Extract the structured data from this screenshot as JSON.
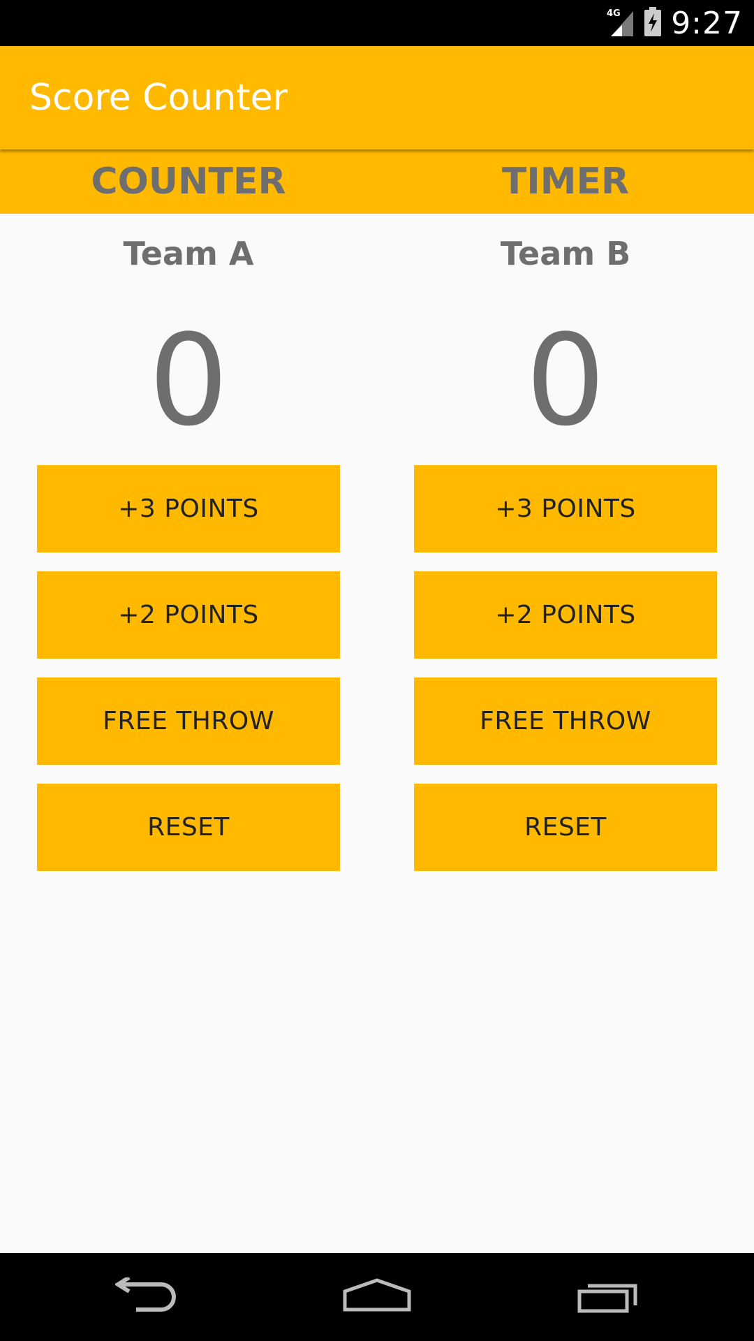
{
  "status_bar": {
    "network": "4G",
    "time": "9:27"
  },
  "app_bar": {
    "title": "Score Counter"
  },
  "tabs": [
    {
      "label": "COUNTER"
    },
    {
      "label": "TIMER"
    }
  ],
  "teams": [
    {
      "name": "Team A",
      "score": "0",
      "buttons": [
        "+3 POINTS",
        "+2 POINTS",
        "FREE THROW",
        "RESET"
      ]
    },
    {
      "name": "Team B",
      "score": "0",
      "buttons": [
        "+3 POINTS",
        "+2 POINTS",
        "FREE THROW",
        "RESET"
      ]
    }
  ],
  "nav_bar": {
    "icons": [
      "back-icon",
      "home-icon",
      "recents-icon"
    ]
  },
  "colors": {
    "accent": "#FFB900",
    "text_gray": "#6E6E6E",
    "button_text": "#222222",
    "background": "#FAFAFA"
  }
}
